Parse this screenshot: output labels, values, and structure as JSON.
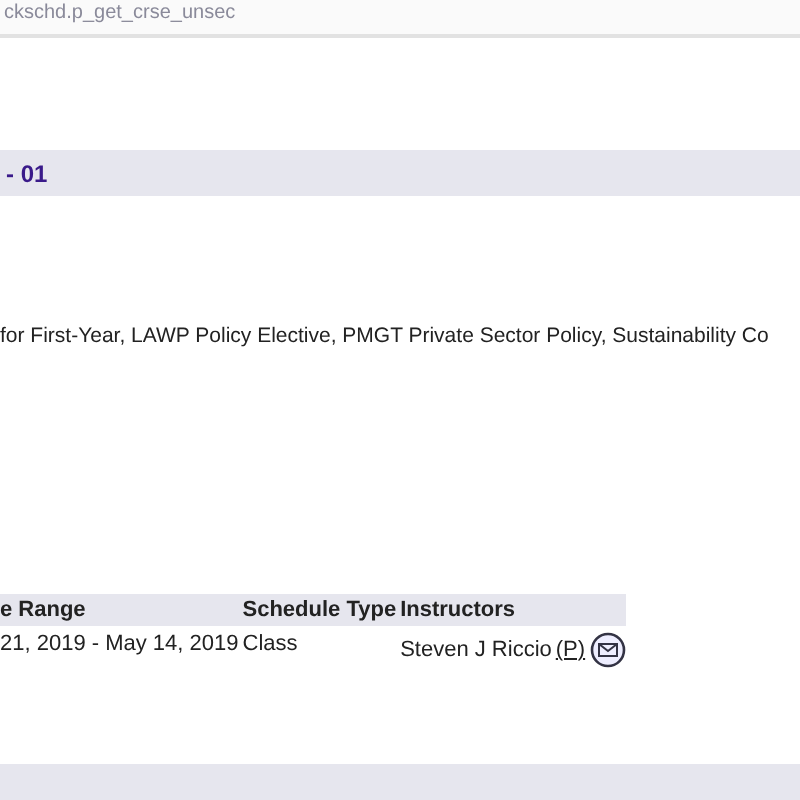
{
  "address_bar": {
    "url": "ckschd.p_get_crse_unsec"
  },
  "section_header": {
    "title": "- 01"
  },
  "attributes": {
    "text": "for First-Year, LAWP Policy Elective, PMGT Private Sector Policy, Sustainability Co"
  },
  "table": {
    "columns": [
      "e Range",
      "Schedule Type",
      "Instructors"
    ],
    "rows": [
      {
        "date_range": "21, 2019 - May 14, 2019",
        "schedule_type": "Class",
        "instructor": "Steven J Riccio",
        "primary": "(P)"
      }
    ]
  },
  "next_section_header": {
    "kind": "band"
  }
}
